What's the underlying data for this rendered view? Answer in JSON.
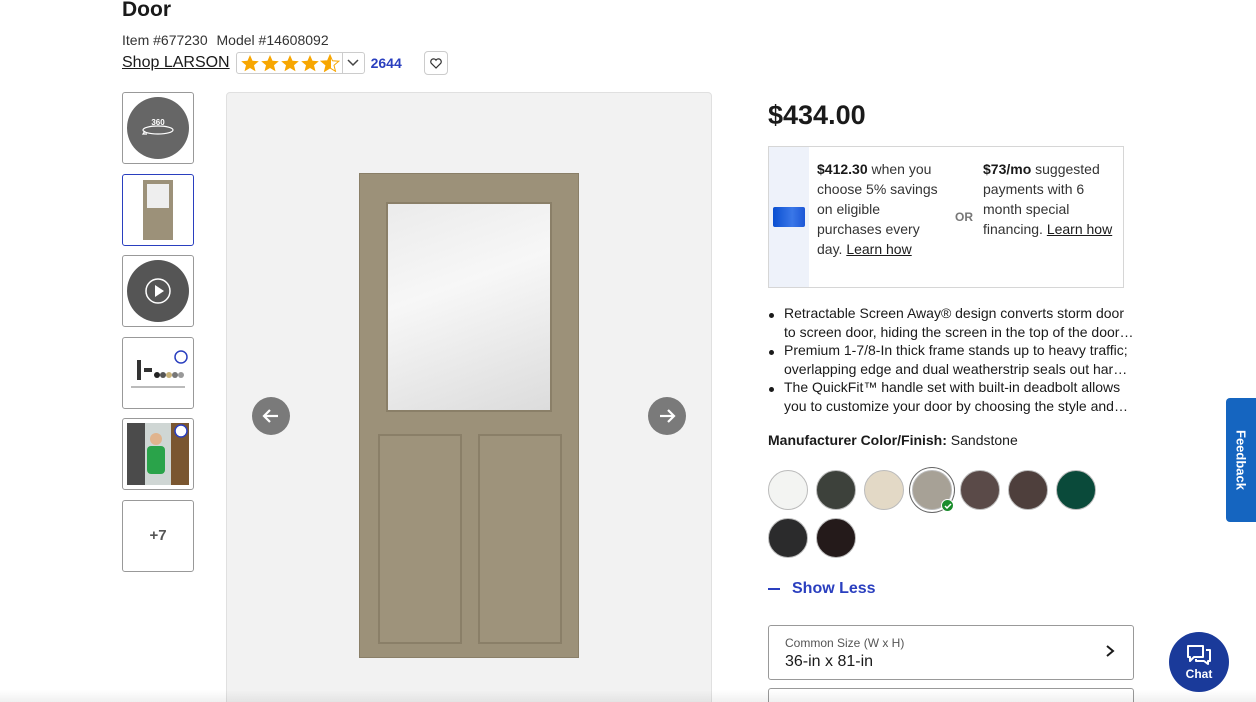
{
  "product": {
    "title": "Door",
    "item_number": "Item #677230",
    "model_number": "Model #14608092",
    "shop_link": "Shop LARSON",
    "rating": 4.5,
    "review_count": "2644"
  },
  "gallery": {
    "thumb_360_label": "360",
    "more_label": "+7"
  },
  "pricing": {
    "price": "$434.00",
    "promo_left_bold": "$412.30",
    "promo_left_text": " when you choose 5% savings on eligible purchases every day. ",
    "promo_left_link": "Learn how",
    "or_label": "OR",
    "promo_right_bold": "$73/mo",
    "promo_right_text": " suggested payments with 6 month special financing. ",
    "promo_right_link": "Learn how"
  },
  "features": [
    {
      "line1": "Retractable Screen Away® design converts storm door",
      "line2": "to screen door, hiding the screen in the top of the door…"
    },
    {
      "line1": "Premium 1-7/8-In thick frame stands up to heavy traffic;",
      "line2": "overlapping edge and dual weatherstrip seals out har…"
    },
    {
      "line1": "The QuickFit™ handle set with built-in deadbolt allows",
      "line2": "you to customize your door by choosing the style and…"
    }
  ],
  "color": {
    "label": "Manufacturer Color/Finish:",
    "selected": "Sandstone",
    "swatches": [
      "#f3f4f2",
      "#3d413b",
      "#e3d9c6",
      "#a7a196",
      "#5a4a48",
      "#4e3f3c",
      "#0a4a3a",
      "#2b2b2c",
      "#241a1a"
    ],
    "selected_index": 3
  },
  "toggle": {
    "show_less": "Show Less"
  },
  "size": {
    "label": "Common Size (W x H)",
    "value": "36-in x 81-in"
  },
  "feedback_label": "Feedback",
  "chat_label": "Chat"
}
